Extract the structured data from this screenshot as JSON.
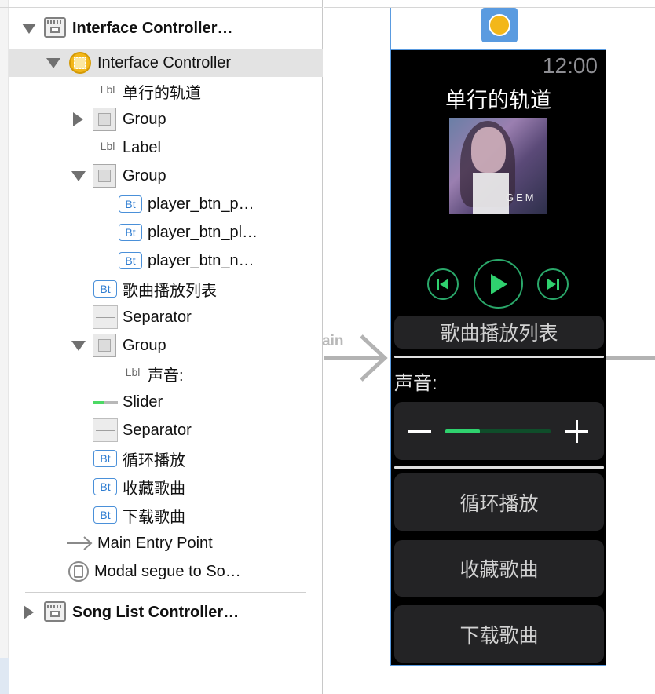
{
  "outline": {
    "rows": [
      {
        "label": "Interface Controller…"
      },
      {
        "label": "Interface Controller"
      },
      {
        "label": "单行的轨道"
      },
      {
        "label": "Group"
      },
      {
        "label": "Label"
      },
      {
        "label": "Group"
      },
      {
        "label": "player_btn_p…"
      },
      {
        "label": "player_btn_pl…"
      },
      {
        "label": "player_btn_n…"
      },
      {
        "label": "歌曲播放列表"
      },
      {
        "label": "Separator"
      },
      {
        "label": "Group"
      },
      {
        "label": "声音:"
      },
      {
        "label": "Slider"
      },
      {
        "label": "Separator"
      },
      {
        "label": "循环播放"
      },
      {
        "label": "收藏歌曲"
      },
      {
        "label": "下载歌曲"
      },
      {
        "label": "Main Entry Point"
      },
      {
        "label": "Modal segue to So…"
      },
      {
        "label": "Song List Controller…"
      }
    ],
    "type_badges": {
      "label": "Lbl",
      "button": "Bt"
    }
  },
  "canvas": {
    "segue_label": "ain",
    "watch": {
      "time": "12:00",
      "title": "单行的轨道",
      "album_logo": "GEM",
      "playlist_button": "歌曲播放列表",
      "volume_label": "声音:",
      "volume_level": 0.33,
      "loop_button": "循环播放",
      "favorite_button": "收藏歌曲",
      "download_button": "下载歌曲",
      "accent_color": "#2fd16e"
    }
  },
  "colors": {
    "selection": "#e3e3e3",
    "controller_icon": "#f3b71a",
    "button_badge": "#2f7dd1",
    "storyboard_blue": "#5a9be0"
  }
}
